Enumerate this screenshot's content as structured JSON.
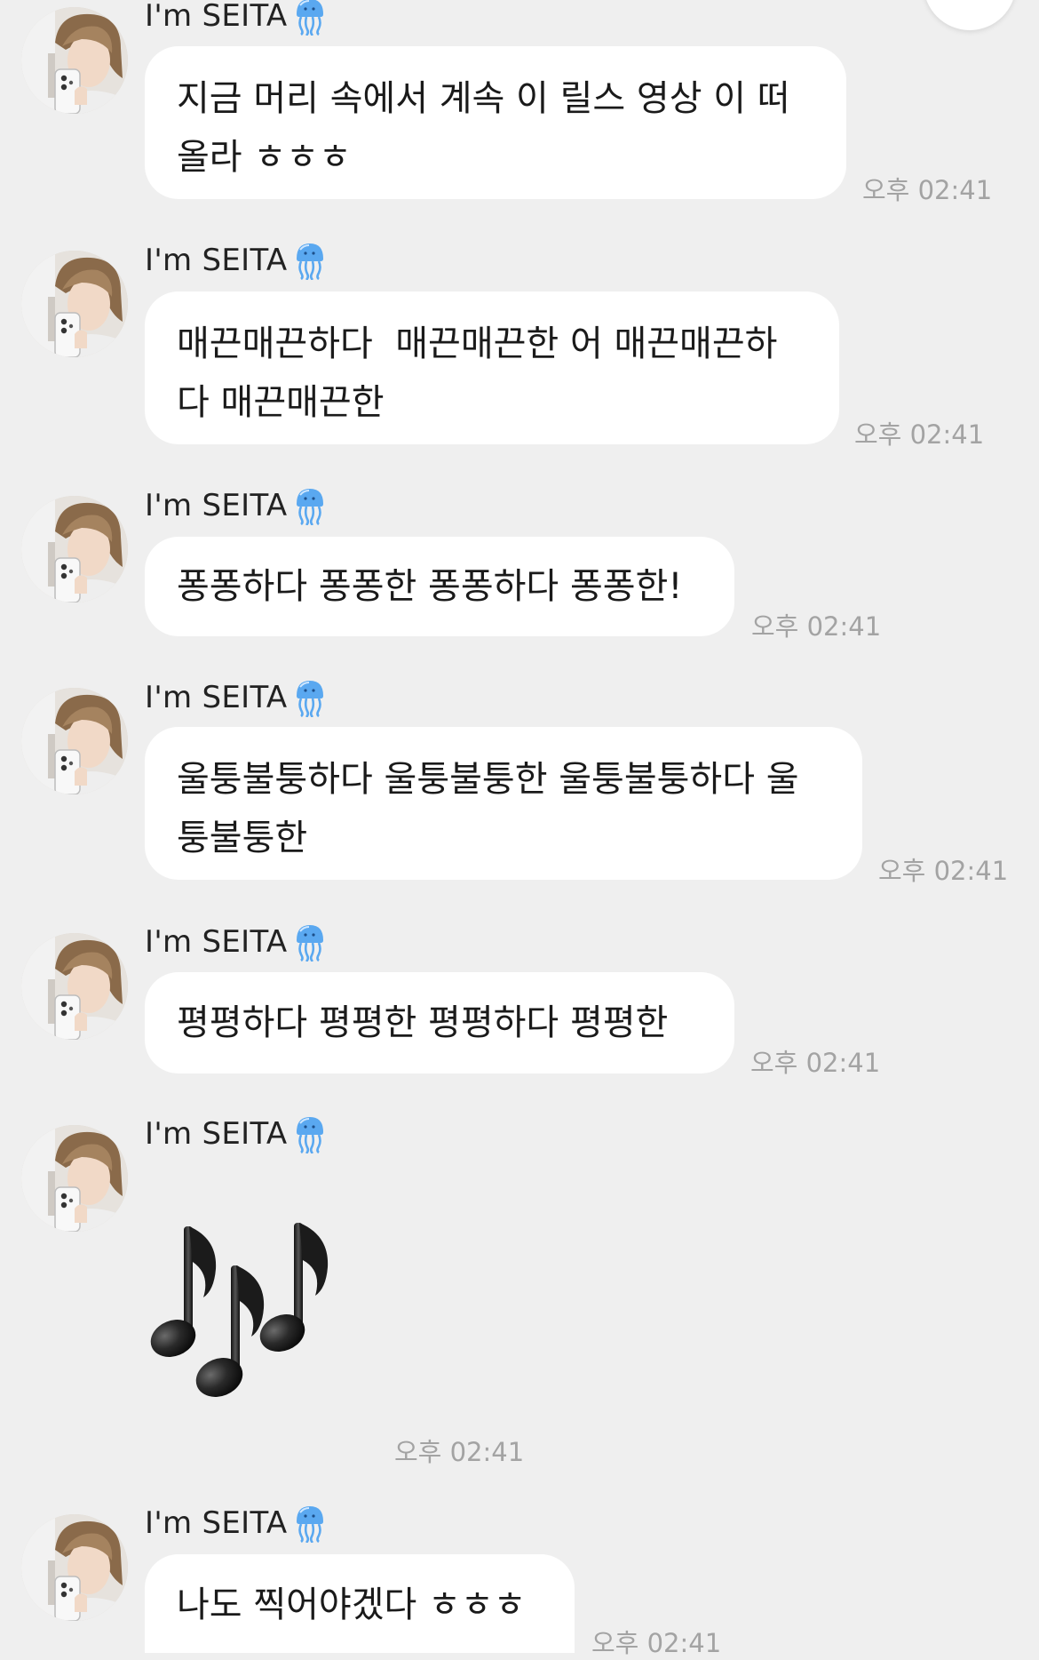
{
  "colors": {
    "background": "#efefef",
    "bubble": "#ffffff",
    "timestamp": "#a3a3a3",
    "text": "#1a1a1a",
    "badge": "#5aa8f0",
    "heart": "#e79ac0"
  },
  "icons": {
    "badge": "jellyfish-icon",
    "reaction": "heart-icon",
    "sticker": "musical-notes-sticker"
  },
  "messages": [
    {
      "sender": "I'm SEITA",
      "text": "지금 머리 속에서 계속 이 릴스 영상 이 떠\n올라 ㅎㅎㅎ",
      "time": "오후 02:41"
    },
    {
      "sender": "I'm SEITA",
      "text": "매끈매끈하다  매끈매끈한 어 매끈매끈하\n다 매끈매끈한",
      "time": "오후 02:41"
    },
    {
      "sender": "I'm SEITA",
      "text": "퐁퐁하다 퐁퐁한 퐁퐁하다 퐁퐁한!",
      "time": "오후 02:41"
    },
    {
      "sender": "I'm SEITA",
      "text": "울퉁불퉁하다 울퉁불퉁한 울퉁불퉁하다 울\n퉁불퉁한",
      "time": "오후 02:41"
    },
    {
      "sender": "I'm SEITA",
      "text": "평평하다 평평한 평평하다 평평한",
      "time": "오후 02:41"
    },
    {
      "sender": "I'm SEITA",
      "sticker": "musical-notes",
      "time": "오후 02:41"
    },
    {
      "sender": "I'm SEITA",
      "text": "나도 찍어야겠다 ㅎㅎㅎ",
      "time": "오후 02:41"
    }
  ]
}
